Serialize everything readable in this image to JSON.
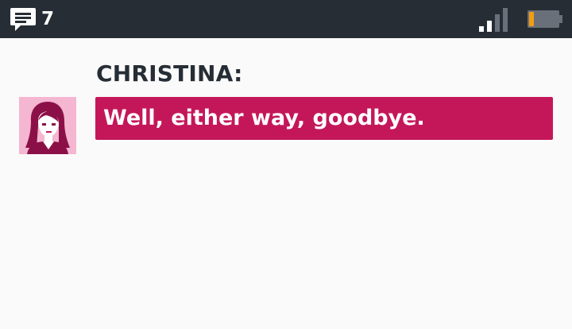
{
  "status_bar": {
    "message_icon": "chat-bubble-icon",
    "message_count": "7",
    "signal_icon": "signal-strength-icon",
    "battery_icon": "battery-low-icon",
    "battery_level": 0.15,
    "colors": {
      "bar": "#262d35",
      "battery_fill": "#f39c12"
    }
  },
  "conversation": {
    "speaker": "CHRISTINA:",
    "message": "Well, either way, goodbye.",
    "avatar_icon": "christina-portrait-icon",
    "colors": {
      "bubble": "#c4175a",
      "avatar_bg": "#f4b6d1"
    }
  }
}
